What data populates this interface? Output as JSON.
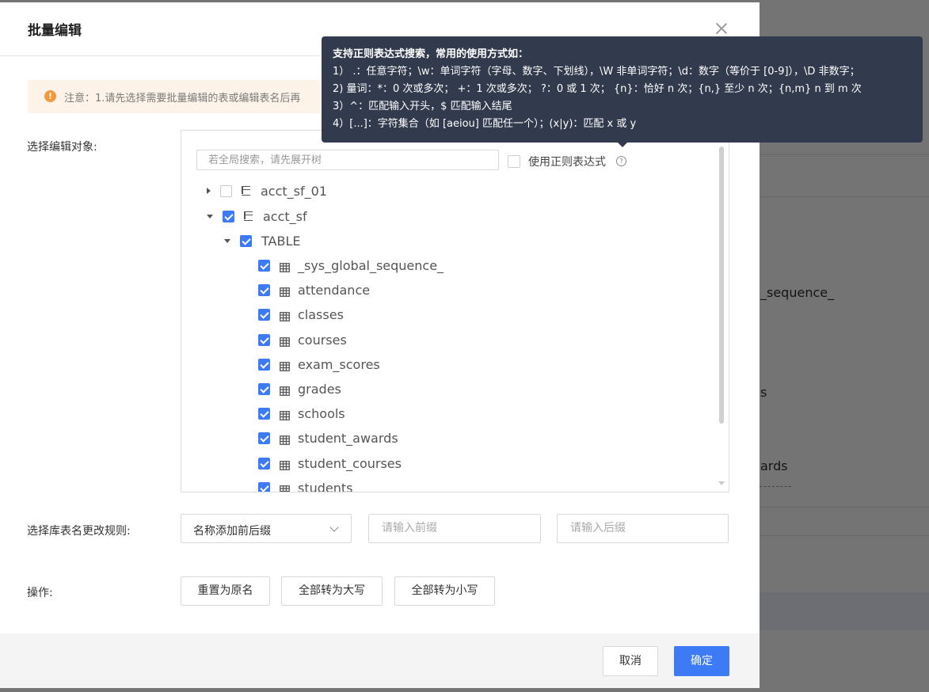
{
  "dialog": {
    "title": "批量编辑",
    "notice": "注意：1.请先选择需要批量编辑的表或编辑表名后再"
  },
  "labels": {
    "select_objects": "选择编辑对象:",
    "rename_rule": "选择库表名更改规则:",
    "operation": "操作:"
  },
  "tree": {
    "search_placeholder": "若全局搜索，请先展开树",
    "regex_label": "使用正则表达式",
    "nodes": [
      {
        "label": "acct_sf_01",
        "checked": false,
        "expanded": false
      },
      {
        "label": "acct_sf",
        "checked": true,
        "expanded": true
      },
      {
        "label": "TABLE",
        "checked": true,
        "expanded": true
      }
    ],
    "tables": [
      "_sys_global_sequence_",
      "attendance",
      "classes",
      "courses",
      "exam_scores",
      "grades",
      "schools",
      "student_awards",
      "student_courses",
      "students"
    ]
  },
  "rule": {
    "selected": "名称添加前后缀",
    "prefix_placeholder": "请输入前缀",
    "suffix_placeholder": "请输入后缀"
  },
  "operations": {
    "reset": "重置为原名",
    "upper": "全部转为大写",
    "lower": "全部转为小写"
  },
  "footer": {
    "cancel": "取消",
    "ok": "确定"
  },
  "tooltip": {
    "lines": [
      "支持正则表达式搜索，常用的使用方式如：",
      "1） .：任意字符；\\w：单词字符（字母、数字、下划线），\\W 非单词字符；\\d：数字（等价于 [0-9]），\\D 非数字；",
      "2) 量词：*：0 次或多次；  +：1 次或多次；  ?：0 或 1 次；  {n}：恰好 n 次；{n,} 至少 n 次；{n,m} n 到 m 次",
      "3）^：匹配输入开头，$ 匹配输入结尾",
      "4）[...]：字符集合（如 [aeiou] 匹配任一个）；(x|y)：匹配 x 或 y"
    ]
  },
  "background": {
    "texts": [
      "_sequence_",
      "s",
      "ards"
    ]
  },
  "colors": {
    "primary": "#3d7af5",
    "warning": "#f5973b",
    "tooltip_bg": "#323a4d"
  }
}
